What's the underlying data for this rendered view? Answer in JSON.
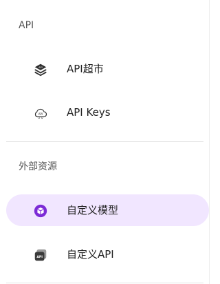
{
  "sidebar": {
    "sections": [
      {
        "title": "API",
        "items": [
          {
            "label": "API超市",
            "icon": "api-market-icon",
            "active": false
          },
          {
            "label": "API Keys",
            "icon": "api-keys-cloud-icon",
            "active": false
          }
        ]
      },
      {
        "title": "外部资源",
        "items": [
          {
            "label": "自定义模型",
            "icon": "custom-model-icon",
            "active": true
          },
          {
            "label": "自定义API",
            "icon": "custom-api-icon",
            "active": false
          }
        ]
      }
    ]
  },
  "colors": {
    "active_bg": "#f1e6ff",
    "accent": "#7c2bd6"
  }
}
